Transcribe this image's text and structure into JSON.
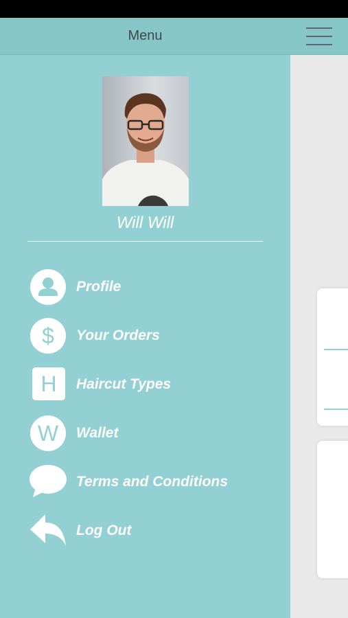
{
  "header": {
    "title": "Menu"
  },
  "user": {
    "name": "Will Will"
  },
  "menu": {
    "items": [
      {
        "label": "Profile",
        "icon": "person-icon"
      },
      {
        "label": "Your Orders",
        "icon": "dollar-icon"
      },
      {
        "label": "Haircut Types",
        "icon": "letter-h-icon",
        "glyph": "H"
      },
      {
        "label": "Wallet",
        "icon": "letter-w-icon",
        "glyph": "W"
      },
      {
        "label": "Terms and Conditions",
        "icon": "speech-bubble-icon"
      },
      {
        "label": "Log Out",
        "icon": "reply-arrow-icon"
      }
    ],
    "dollar_glyph": "$"
  },
  "colors": {
    "header_bg": "#86c5c8",
    "drawer_bg": "#93d0d3",
    "content_bg": "#e9e9e9"
  }
}
